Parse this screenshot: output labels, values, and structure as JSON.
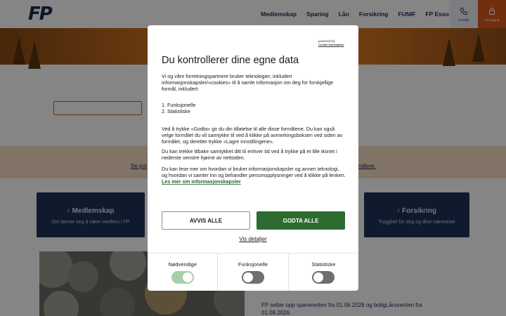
{
  "header": {
    "logo": "FP",
    "nav": [
      "Medlemskap",
      "Sparing",
      "Lån",
      "Forsikring",
      "FUNIF",
      "FP Esso"
    ],
    "contact_label": "Kontakt",
    "login_label": "Innlogging"
  },
  "band": {
    "left_link": "Se pol",
    "right_link": "ndlere."
  },
  "tiles": {
    "left": {
      "title": "Medlemskap",
      "subtitle": "Det lønner seg å være medlem i FP"
    },
    "right": {
      "title": "Forsikring",
      "subtitle": "Trygghet for deg og dine nærmeste"
    }
  },
  "news": {
    "text": "FP setter opp sparerenten fra 01.06.2026 og boligLånsrenten fra 01.08.2026."
  },
  "dialog": {
    "powered_by": "powered by:",
    "powered_by_brand": "Cookie Information",
    "title": "Du kontrollerer dine egne data",
    "intro": "Vi og våre forretningspartnere bruker teknologier, inkludert informasjonskapsler/«cookies» til å samle informasjon om deg for forskjellige formål, inkludert:",
    "purposes": [
      "1. Funksjonelle",
      "2. Statistiske"
    ],
    "p_accept": "Ved å trykke «Godta» gir du din tillatelse til alle disse formålene. Du kan også velge formålet du vil samtykke til ved å klikke på avmerkingsboksen ved siden av formålet, og deretter trykke «Lagre innstillingene».",
    "p_withdraw": "Du kan trekke tilbake samtykket ditt til enhver tid ved å trykke på et lille ikonet i nederste venstre hjørne av nettsiden.",
    "p_more": "Du kan lese mer om hvordan vi bruker informasjonskapsler og annen teknologi, og hvordan vi samler inn og behandler personopplysninger ved å klikke på lenken.",
    "more_link": "Les mer om informasjonskapsler",
    "reject_label": "AVVIS ALLE",
    "accept_label": "GODTA ALLE",
    "details_label": "Vis detaljer",
    "toggles": [
      {
        "label": "Nødvendige",
        "on": true
      },
      {
        "label": "Funksjonelle",
        "on": false
      },
      {
        "label": "Statistiske",
        "on": false
      }
    ]
  },
  "colors": {
    "brand_navy": "#1e2a55",
    "accent_orange": "#d85a20",
    "accept_green": "#2e6b30"
  }
}
